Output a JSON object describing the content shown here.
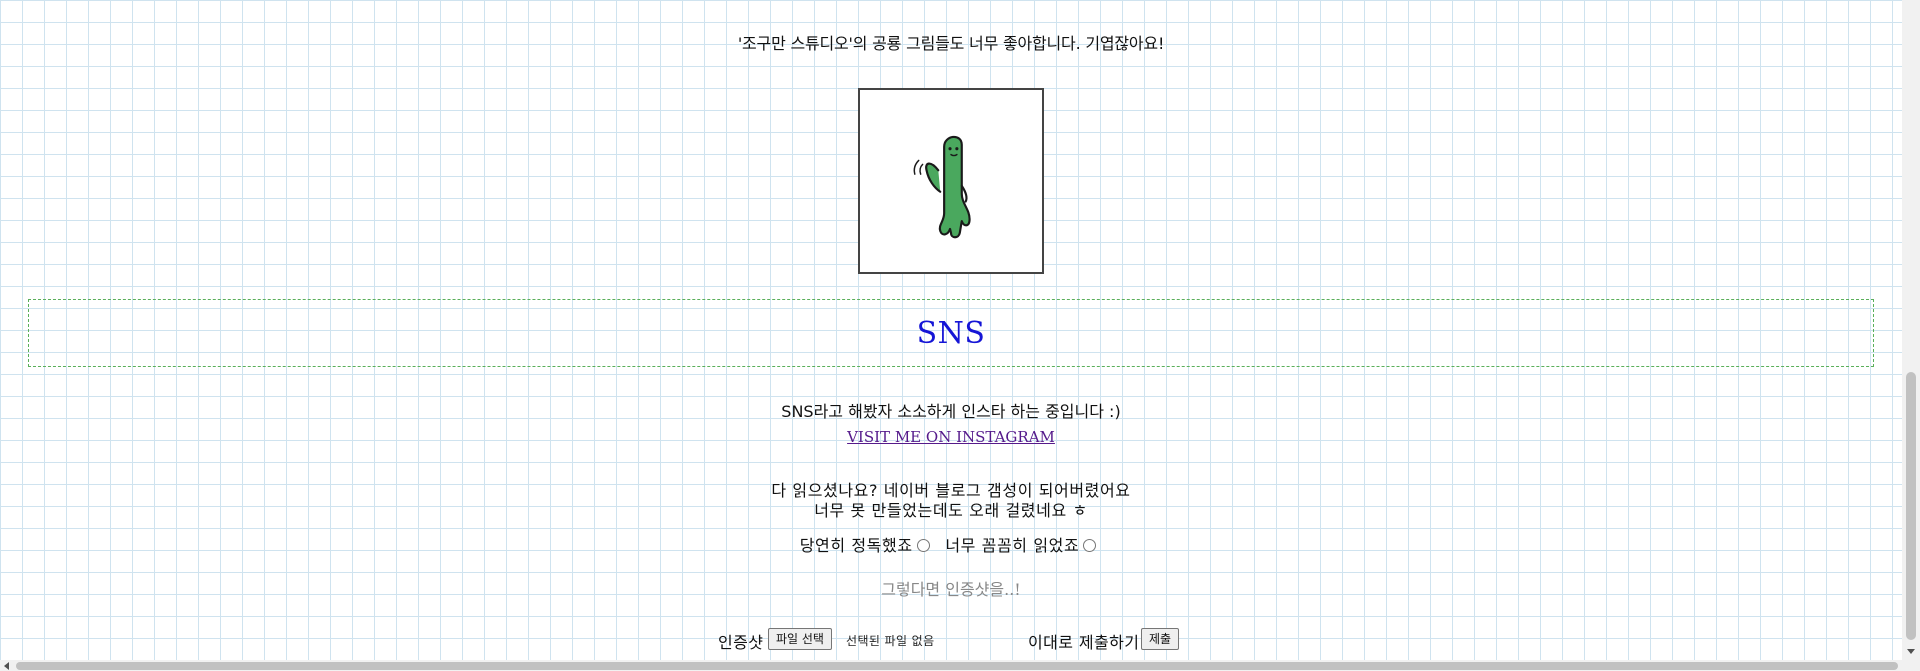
{
  "gallery": {
    "caption": "'조구만 스튜디오'의 공룡 그림들도 너무 좋아합니다. 기엽잖아요!",
    "image_icon": "green-dinosaur-waving-icon"
  },
  "sns_section": {
    "title": "SNS",
    "description": "SNS라고 해봤자 소소하게 인스타 하는 중입니다 :)",
    "link_label": "VISIT ME ON INSTAGRAM"
  },
  "survey": {
    "line1": "다 읽으셨나요? 네이버 블로그 갬성이 되어버렸어요",
    "line2": "너무 못 만들었는데도 오래 걸렸네요 ㅎ",
    "options": [
      {
        "label": "당연히 정독했죠"
      },
      {
        "label": "너무 꼼꼼히 읽었죠"
      }
    ],
    "hint": "그렇다면 인증샷을..!"
  },
  "upload": {
    "label": "인증샷",
    "file_button": "파일 선택",
    "file_status": "선택된 파일 없음",
    "submit_label": "이대로 제출하기",
    "submit_button": "제출"
  },
  "colors": {
    "grid_line": "#cfe3ef",
    "section_title": "#1515d6",
    "section_border": "#5aaf5a",
    "visited_link": "#551a8b",
    "dino_green": "#4aa85e"
  }
}
